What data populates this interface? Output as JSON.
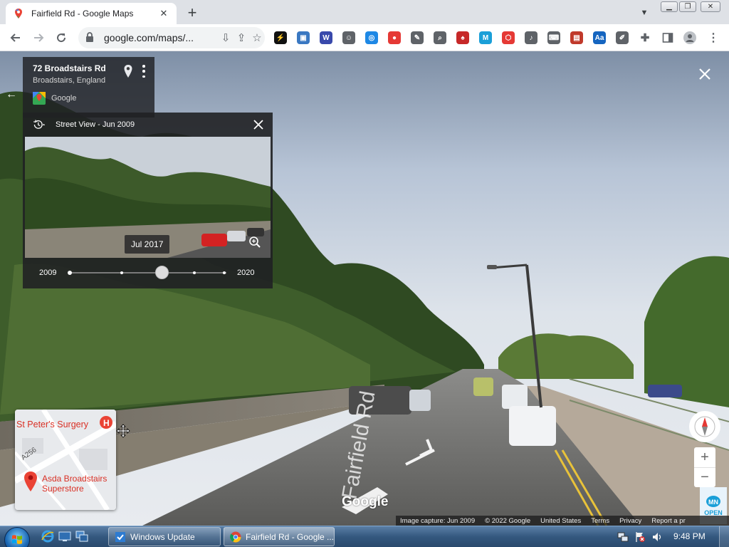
{
  "browser": {
    "tab_title": "Fairfield Rd - Google Maps",
    "url": "google.com/maps/...",
    "new_tab_label": "+",
    "extensions": [
      {
        "name": "ext-1",
        "color": "#111111",
        "glyph": "⚡"
      },
      {
        "name": "ext-2",
        "color": "#3a78c2",
        "glyph": "▣"
      },
      {
        "name": "ext-3",
        "color": "#3949ab",
        "glyph": "W"
      },
      {
        "name": "ext-4",
        "color": "#5f6368",
        "glyph": "☺"
      },
      {
        "name": "ext-5",
        "color": "#1e88e5",
        "glyph": "◎"
      },
      {
        "name": "ext-6",
        "color": "#e53935",
        "glyph": "●"
      },
      {
        "name": "ext-7",
        "color": "#5f6368",
        "glyph": "✎"
      },
      {
        "name": "ext-8",
        "color": "#5f6368",
        "glyph": "⌕"
      },
      {
        "name": "ext-9",
        "color": "#c62828",
        "glyph": "♠"
      },
      {
        "name": "ext-10",
        "color": "#1a9fd8",
        "glyph": "M"
      },
      {
        "name": "ext-11",
        "color": "#e53935",
        "glyph": "⬡"
      },
      {
        "name": "ext-12",
        "color": "#5f6368",
        "glyph": "♪"
      },
      {
        "name": "ext-13",
        "color": "#5f6368",
        "glyph": "⌨"
      },
      {
        "name": "ext-14",
        "color": "#c0392b",
        "glyph": "▤"
      },
      {
        "name": "ext-15",
        "color": "#1565c0",
        "glyph": "Aa"
      },
      {
        "name": "ext-16",
        "color": "#5f6368",
        "glyph": "✐"
      }
    ]
  },
  "place_card": {
    "address": "72 Broadstairs Rd",
    "locality": "Broadstairs, England",
    "source": "Google"
  },
  "timeline": {
    "header": "Street View - Jun 2009",
    "preview_date": "Jul 2017",
    "start_year": "2009",
    "end_year": "2020"
  },
  "street_label": "Fairfield Rd",
  "watermark": "Google",
  "footer": {
    "capture": "Image capture: Jun 2009",
    "copyright": "© 2022 Google",
    "country": "United States",
    "terms": "Terms",
    "privacy": "Privacy",
    "report": "Report a pr"
  },
  "minimap": {
    "place1": "St Peter's Surgery",
    "place2_line1": "Asda Broadstairs",
    "place2_line2": "Superstore",
    "road": "A256"
  },
  "controls": {
    "zoom_in": "+",
    "zoom_out": "−",
    "open_badge": "OPEN"
  },
  "taskbar": {
    "windows_update": "Windows Update",
    "chrome_window": "Fairfield Rd - Google ...",
    "clock": "9:48 PM"
  }
}
